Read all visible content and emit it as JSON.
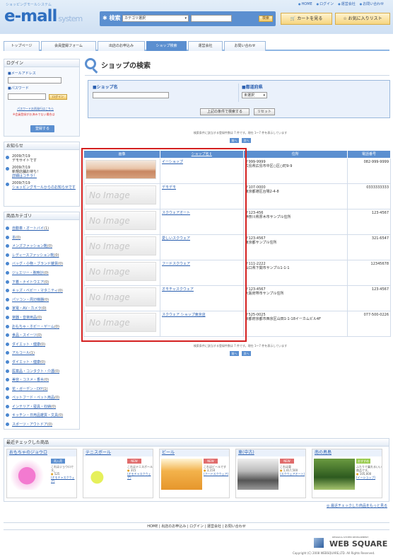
{
  "header": {
    "tagline": "ショッピングモールシステム",
    "logo": "e-mall",
    "logo_sub": "system",
    "top_links": [
      "HOME",
      "ログイン",
      "運営会社",
      "お問い合わせ"
    ],
    "search_label": "検索",
    "category_select": "カテゴリ選択",
    "search_button": "検索",
    "cart_button": "カートを見る",
    "fav_button": "お気に入りリスト"
  },
  "nav": {
    "tabs": [
      "トップページ",
      "会員登録フォーム",
      "出店のお申込み",
      "ショップ検索",
      "運営会社",
      "お問い合わせ"
    ],
    "active": 3
  },
  "login": {
    "title": "ログイン",
    "email_label": "■メールアドレス",
    "password_label": "■パスワード",
    "login_button": "ログイン",
    "forgot": "パスワードお再発行はこちら",
    "note": "※会員登録がお済みでない場合は",
    "register_button": "登録する"
  },
  "news": {
    "title": "お知らせ",
    "items": [
      {
        "date": "2009/7/19",
        "text": "デモサイトです",
        "link": ""
      },
      {
        "date": "2009/7/19",
        "text": "新規店舗お待ち！",
        "link": "詳細はコチラ！"
      },
      {
        "date": "2009/7/19",
        "text": "",
        "link": "ショッピングモールからのお知らせです"
      }
    ]
  },
  "categories": {
    "title": "商品カテゴリ",
    "items": [
      {
        "name": "自動車・オートバイ",
        "count": "(1)"
      },
      {
        "name": "本",
        "count": "(0)"
      },
      {
        "name": "メンズファッション靴",
        "count": "(0)"
      },
      {
        "name": "レディースファッション靴",
        "count": "(0)"
      },
      {
        "name": "バッグ・小物・ブランド雑貨",
        "count": "(0)"
      },
      {
        "name": "ジュエリー・腕時計",
        "count": "(0)"
      },
      {
        "name": "下着・ナイトウエア",
        "count": "(0)"
      },
      {
        "name": "キッズ・ベビー・マタニティ",
        "count": "(0)"
      },
      {
        "name": "パソコン・周辺機器",
        "count": "(0)"
      },
      {
        "name": "家電・AV・カメラ",
        "count": "(0)"
      },
      {
        "name": "楽器・音楽用品",
        "count": "(0)"
      },
      {
        "name": "おもちゃ・ホビー・ゲーム",
        "count": "(0)"
      },
      {
        "name": "食品・スイーツ",
        "count": "(0)"
      },
      {
        "name": "ダイエット・健康",
        "count": "(0)"
      },
      {
        "name": "アルコール",
        "count": "(1)"
      },
      {
        "name": "ダイエット・健康",
        "count": "(0)"
      },
      {
        "name": "医薬品・コンタクト・介護",
        "count": "(0)"
      },
      {
        "name": "美容・コスメ・香水",
        "count": "(0)"
      },
      {
        "name": "花・ガーデン・DIY",
        "count": "(1)"
      },
      {
        "name": "ペットフード・ペット用品",
        "count": "(0)"
      },
      {
        "name": "インテリア・寝具・収納",
        "count": "(0)"
      },
      {
        "name": "キッチン・日用品雑貨・文具",
        "count": "(0)"
      },
      {
        "name": "スポーツ・アウトドア",
        "count": "(0)"
      }
    ]
  },
  "search": {
    "page_title": "ショップの検索",
    "shop_name_label": "■ショップ名",
    "pref_label": "■都道府県",
    "pref_select": "未選択",
    "search_button": "上記の条件で検索する",
    "reset_button": "リセット"
  },
  "pager": {
    "summary": "検索条件に該当する登録件数は 7 件です。現在 1〜7 件を表示しています",
    "prev": "前へ",
    "next": "次へ"
  },
  "results": {
    "headers": [
      "画像",
      "ショップ名↕",
      "住所",
      "電話番号"
    ],
    "rows": [
      {
        "name": "イーショップ",
        "zip": "〒999-9999",
        "addr": "広島県広島市中区○区○町9-9",
        "tel": "082-999-9999",
        "img": "photo"
      },
      {
        "name": "デモデモ",
        "zip": "〒107-0000",
        "addr": "東京都港区台場2-4-8",
        "tel": "0333333333",
        "img": "none"
      },
      {
        "name": "スクウェアオート",
        "zip": "〒123-456",
        "addr": "神奈川県厚木市サンプル住所",
        "tel": "123-4567",
        "img": "none"
      },
      {
        "name": "愛しいスクウェア",
        "zip": "〒123-4567",
        "addr": "東京都サンプル住所",
        "tel": "321-6547",
        "img": "none"
      },
      {
        "name": "フードスクウェア",
        "zip": "〒111-2222",
        "addr": "山口県下関市サンプル1-1-1",
        "tel": "12345678",
        "img": "none"
      },
      {
        "name": "オモチャスクウェア",
        "zip": "〒123-4567",
        "addr": "大阪府堺市サンプル住所",
        "tel": "123-4567",
        "img": "none"
      },
      {
        "name": "スクウェア ショップ東京店",
        "zip": "〒525-0025",
        "addr": "京都府京都市西京区山田1-1-18イーカムビル4F",
        "tel": "077-500-0226",
        "img": "none"
      }
    ]
  },
  "no_image": "No Image",
  "recent": {
    "title": "最近チェックした商品",
    "more": "最近チェックした商品をもっと見る",
    "items": [
      {
        "name": "おもちゃのジョウロ",
        "badge": "再入荷",
        "badge_color": "#5b8fd0",
        "text": "これはジョウロです。",
        "price": "525",
        "shop": "(オモチャスクウェア)"
      },
      {
        "name": "テニスボール",
        "badge": "NEW",
        "badge_color": "#e06c6c",
        "text": "これはテニスボール",
        "price": "315",
        "shop": "(オモチャスクウェア)"
      },
      {
        "name": "ビール",
        "badge": "NEW",
        "badge_color": "#e06c6c",
        "text": "これはビールです",
        "price": "3,150",
        "shop": "(フードスクウェア)"
      },
      {
        "name": "車(中古)",
        "badge": "NEW",
        "badge_color": "#e06c6c",
        "text": "これは車",
        "price": "1,417,500",
        "shop": "(スクウェアオート)"
      },
      {
        "name": "南の鳥島",
        "badge": "おすすめ",
        "badge_color": "#9acb4f",
        "text": "ふたりで乗れるいい商品です。",
        "price": "105,000",
        "shop": "(イーショップ)"
      }
    ]
  },
  "footer": {
    "links": "HOME | 出店のお申込み | ログイン | 運営会社 | お問い合わせ",
    "company_tag": "DESIGN & SYSTEM DEVELOPMENT",
    "company": "WEB SQUARE",
    "copyright": "Copyright (C) 2008 WEBSQUARE,LTD. All Rights Reserved."
  }
}
